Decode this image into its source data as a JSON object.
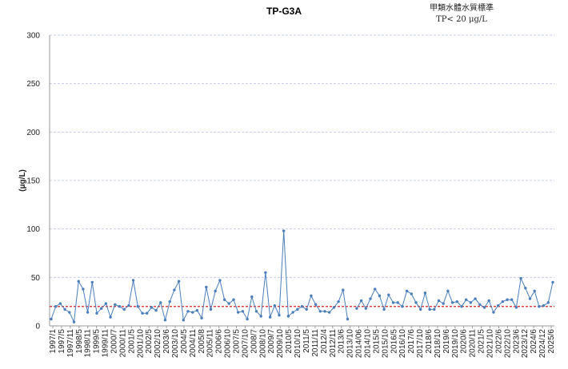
{
  "chart_data": {
    "type": "line",
    "title": "TP-G3A",
    "standard_text": [
      "甲類水體水質標準",
      "TP< 20 μg/L"
    ],
    "ylabel": "(μg/L)",
    "xlabel": "",
    "ylim": [
      0,
      300
    ],
    "yticks": [
      0,
      50,
      100,
      150,
      200,
      250,
      300
    ],
    "grid": true,
    "standard_value": 20,
    "colors": {
      "series": "#4a7ebb",
      "standard": "#e02020",
      "grid": "#c5cbe8"
    },
    "x_tick_labels": [
      "1997/1",
      "1997/5",
      "1997/11",
      "1998/5",
      "1998/11",
      "1999/5",
      "1999/11",
      "2000/7",
      "2000/11",
      "2001/5",
      "2001/10",
      "2002/5",
      "2002/10",
      "2003/6",
      "2003/10",
      "2004/5",
      "2004/11",
      "2005/8",
      "2005/11",
      "2006/6",
      "2006/10",
      "2007/5",
      "2007/10",
      "2008/7",
      "2008/10",
      "2009/7",
      "2009/10",
      "2010/5",
      "2010/10",
      "2011/5",
      "2011/11",
      "2012/4",
      "2012/11",
      "2013/6",
      "2013/10",
      "2014/06",
      "2014/10",
      "2015/5",
      "2015/10",
      "2016/5",
      "2016/10",
      "2017/6",
      "2017/10",
      "2018/6",
      "2018/10",
      "2019/6",
      "2019/10",
      "2020/6",
      "2020/11",
      "2021/5",
      "2021/10",
      "2022/6",
      "2022/10",
      "2023/6",
      "2023/12",
      "2024/6",
      "2024/12",
      "2025/6"
    ],
    "series": [
      {
        "values": [
          7,
          20,
          23,
          17,
          14,
          4,
          46,
          38,
          14,
          45,
          13,
          18,
          23,
          9,
          22,
          20,
          17,
          21,
          47,
          20,
          13,
          13,
          19,
          16,
          24,
          6,
          25,
          37,
          46,
          6,
          15,
          14,
          16,
          8,
          40,
          17,
          36,
          47,
          27,
          23,
          27,
          14,
          15,
          7,
          30,
          15,
          10,
          55,
          9,
          21,
          11,
          98,
          10,
          14,
          17,
          20,
          17,
          31,
          22,
          15,
          15,
          14,
          19,
          25,
          37,
          7,
          null,
          18,
          26,
          18,
          28,
          38,
          31,
          17,
          32,
          24,
          24,
          20,
          36,
          33,
          24,
          17,
          34,
          17,
          17,
          26,
          23,
          36,
          24,
          25,
          20,
          27,
          24,
          28,
          22,
          19,
          26,
          14,
          21,
          25,
          27,
          27,
          19,
          49,
          39,
          28,
          36,
          20,
          21,
          24,
          45
        ]
      }
    ]
  }
}
